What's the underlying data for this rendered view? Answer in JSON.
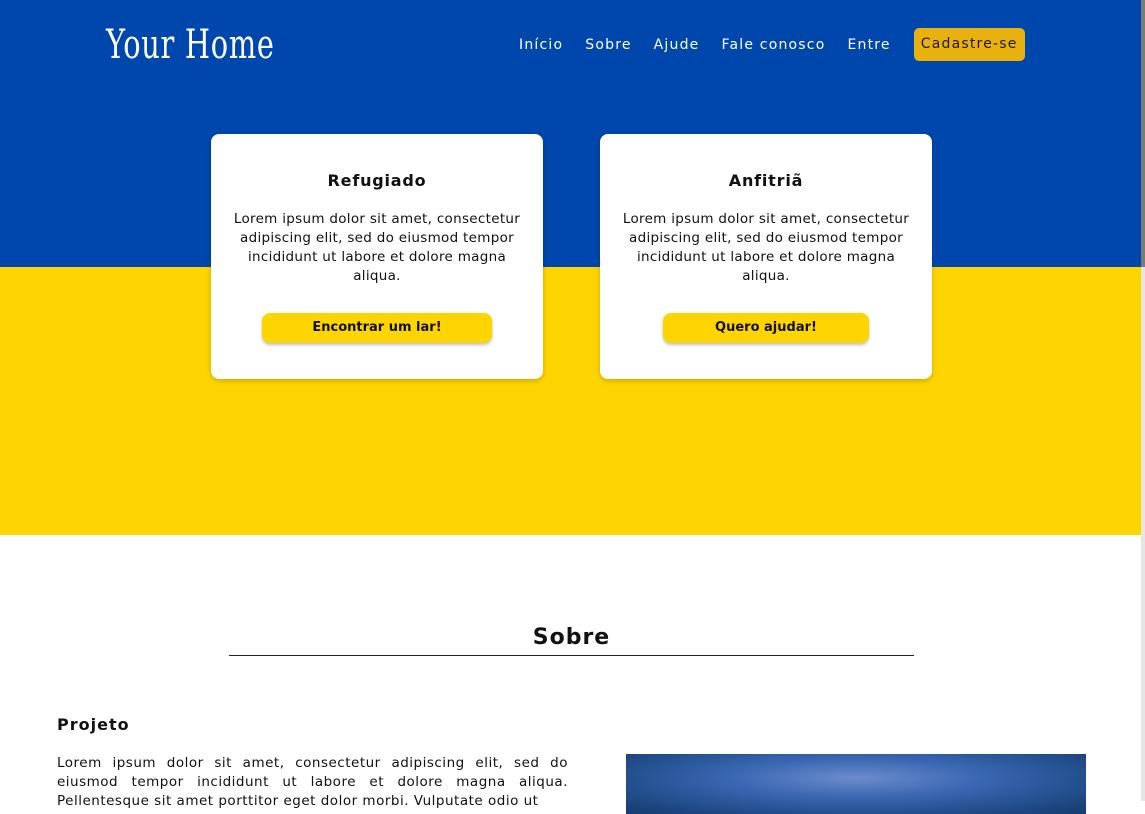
{
  "header": {
    "logo": "Your Home",
    "nav": [
      {
        "label": "Início"
      },
      {
        "label": "Sobre"
      },
      {
        "label": "Ajude"
      },
      {
        "label": "Fale conosco"
      },
      {
        "label": "Entre"
      }
    ],
    "cta_label": "Cadastre-se"
  },
  "hero": {
    "colors": {
      "top": "#0047ad",
      "bottom": "#ffd500",
      "cta": "#e8b10e"
    },
    "cards": [
      {
        "title": "Refugiado",
        "text": "Lorem ipsum dolor sit amet, consectetur adipiscing elit, sed do eiusmod tempor incididunt ut labore et dolore magna aliqua.",
        "button": "Encontrar um lar!"
      },
      {
        "title": "Anfitriã",
        "text": "Lorem ipsum dolor sit amet, consectetur adipiscing elit, sed do eiusmod tempor incididunt ut labore et dolore magna aliqua.",
        "button": "Quero ajudar!"
      }
    ]
  },
  "about": {
    "title": "Sobre",
    "subtitle": "Projeto",
    "text": "Lorem ipsum dolor sit amet, consectetur adipiscing elit, sed do eiusmod tempor incididunt ut labore et dolore magna aliqua. Pellentesque sit amet porttitor eget dolor morbi. Vulputate odio ut"
  }
}
